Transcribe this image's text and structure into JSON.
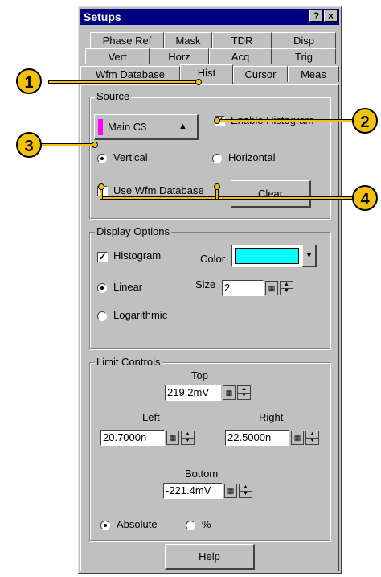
{
  "window": {
    "title": "Setups",
    "help_glyph": "?",
    "close_glyph": "×"
  },
  "tabs": {
    "row1": [
      "Phase Ref",
      "Mask",
      "TDR",
      "Disp"
    ],
    "row2": [
      "Vert",
      "Horz",
      "Acq",
      "Trig"
    ],
    "row3": [
      "Wfm Database",
      "Hist",
      "Cursor",
      "Meas"
    ],
    "active": "Hist"
  },
  "source": {
    "legend": "Source",
    "selector_label": "Main C3",
    "selector_color": "#ff00ff",
    "enable_histogram_label": "Enable Histogram",
    "enable_histogram_checked": true,
    "vertical_label": "Vertical",
    "horizontal_label": "Horizontal",
    "orientation": "Vertical",
    "use_wfm_database_label": "Use Wfm Database",
    "use_wfm_database_checked": false,
    "clear_label": "Clear"
  },
  "display_options": {
    "legend": "Display Options",
    "histogram_label": "Histogram",
    "histogram_checked": true,
    "color_label": "Color",
    "color_value": "#00ffff",
    "linear_label": "Linear",
    "logarithmic_label": "Logarithmic",
    "scale": "Linear",
    "size_label": "Size",
    "size_value": "2"
  },
  "limit_controls": {
    "legend": "Limit Controls",
    "top_label": "Top",
    "top_value": "219.2mV",
    "left_label": "Left",
    "left_value": "20.7000n",
    "right_label": "Right",
    "right_value": "22.5000n",
    "bottom_label": "Bottom",
    "bottom_value": "-221.4mV",
    "absolute_label": "Absolute",
    "percent_label": "%",
    "mode": "Absolute"
  },
  "help_label": "Help",
  "callouts": [
    "1",
    "2",
    "3",
    "4"
  ],
  "colors": {
    "callout": "#f2c00d",
    "title_bar": "#000080",
    "window_bg": "#c0c0c0"
  }
}
